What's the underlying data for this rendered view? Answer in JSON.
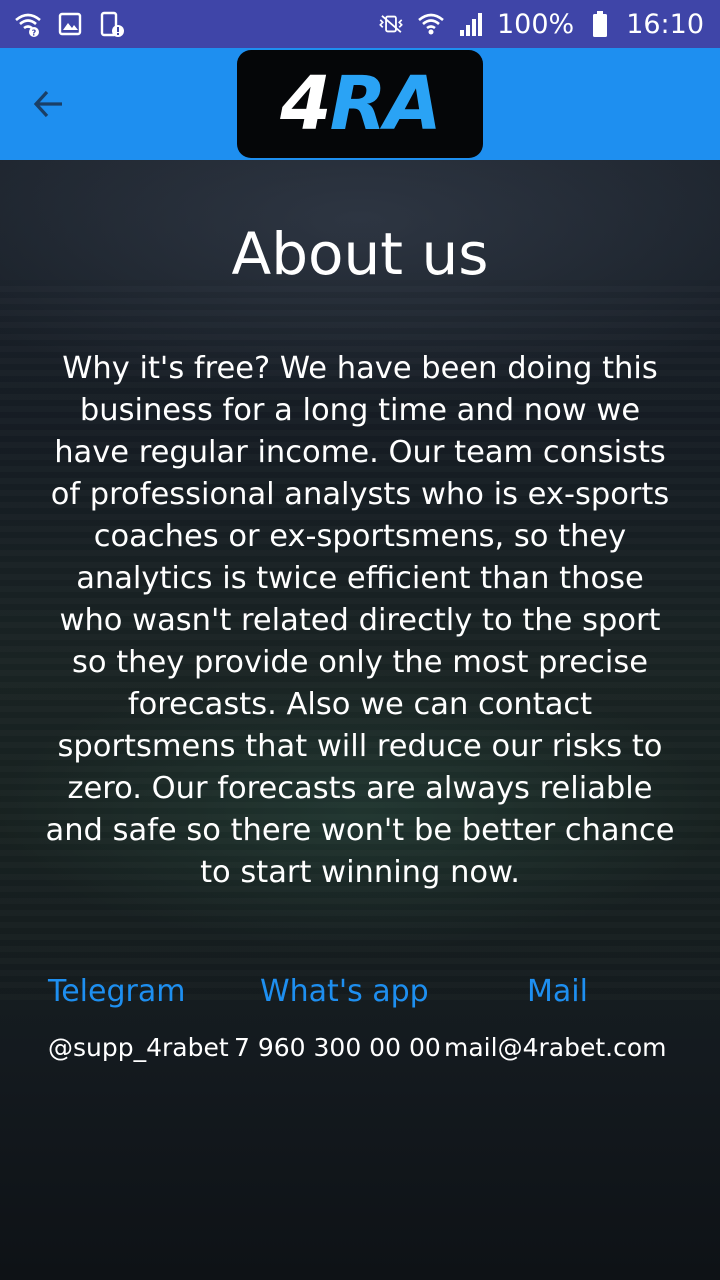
{
  "status_bar": {
    "battery": "100%",
    "time": "16:10",
    "icons": [
      "wifi-question-icon",
      "image-icon",
      "battery-alert-icon",
      "mute-vibrate-icon",
      "wifi-icon",
      "signal-icon",
      "battery-icon"
    ]
  },
  "app_bar": {
    "back_icon": "arrow-left-icon",
    "logo_part1": "4",
    "logo_part2": "RA"
  },
  "page": {
    "title": "About us",
    "body": "Why it's free? We have been doing this business for a long time and now we have regular income. Our team consists of professional analysts who is ex-sports coaches or ex-sportsmens, so they analytics is twice efficient than those who wasn't related directly to the sport so they provide only the most precise forecasts. Also we can contact sportsmens that will reduce our risks to zero. Our forecasts are always reliable and safe so there won't be better chance to start winning now."
  },
  "contacts": {
    "telegram_label": "Telegram",
    "whatsapp_label": "What's app",
    "mail_label": "Mail",
    "telegram_value": "@supp_4rabet",
    "whatsapp_value": "7 960 300 00 00",
    "mail_value": "mail@4rabet.com"
  },
  "colors": {
    "status_bar": "#3f45a8",
    "app_bar": "#1e8ff0",
    "link": "#1e8ff0",
    "logo_bg": "#050608"
  }
}
